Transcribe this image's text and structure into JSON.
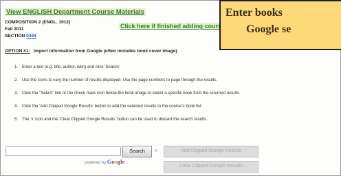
{
  "header": {
    "dept_link": "View ENGLISH  Department Course Materials",
    "course": "COMPOSITION 2 (ENGL. 1012)",
    "term": "Fall 2011",
    "finish_link": "Click here if finished adding course materials",
    "section_label": "SECTION",
    "section_number": "0394"
  },
  "option": {
    "label": "OPTION #1:",
    "text": "Import information from Google (often includes book cover image)"
  },
  "instructions": [
    {
      "num": "1.",
      "text": "Enter a text (e.g. title, author, isbn) and click 'Search'."
    },
    {
      "num": "2.",
      "text": "Use the icons to vary the number of results displayed. Use the page numbers to page through the results."
    },
    {
      "num": "3.",
      "text": "Click the \"Select\" link or the check mark icon below the book image to select a specific book from the returned results."
    },
    {
      "num": "4.",
      "text": "Click the 'Add Clipped Google Results' button to add the selected results to the course's book list."
    },
    {
      "num": "5.",
      "text": "The 'x' icon and the 'Clear Clipped Google Results' button can be used to discard the search results."
    }
  ],
  "search": {
    "input_value": "",
    "search_label": "Search",
    "clear_symbol": "×",
    "add_clipped_label": "Add Clipped Google Results",
    "clear_clipped_label": "Clear Clipped Google Results",
    "powered_by": "powered by",
    "google_letters": [
      "G",
      "o",
      "o",
      "g",
      "l",
      "e"
    ]
  },
  "tooltip": {
    "line1": "Enter books",
    "line2": "Google se"
  },
  "colors": {
    "link_green": "#2f7d2c",
    "link_highlight": "#e6f0cf",
    "tooltip_bg": "#fdd978",
    "tooltip_text": "#3b2a13"
  }
}
